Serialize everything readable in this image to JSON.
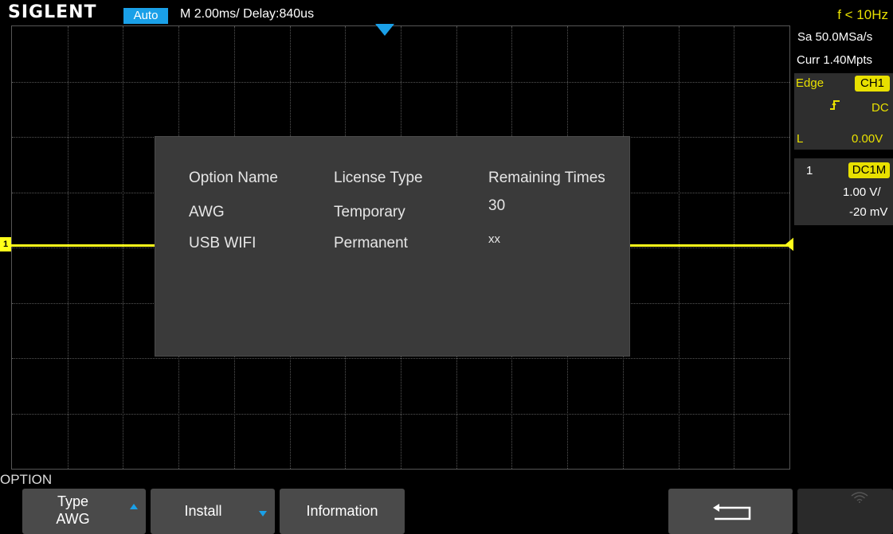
{
  "header": {
    "logo": "SIGLENT",
    "mode": "Auto",
    "timebase": "M 2.00ms/ Delay:840us",
    "frequency": "f < 10Hz"
  },
  "side_panel": {
    "sample_rate": "Sa 50.0MSa/s",
    "memory_depth": "Curr 1.40Mpts",
    "trigger": {
      "type": "Edge",
      "source": "CH1",
      "coupling": "DC",
      "level_label": "L",
      "level_value": "0.00V"
    },
    "channel": {
      "number": "1",
      "coupling_badge": "DC1M",
      "volts_per_div": "1.00 V/",
      "offset": "-20 mV"
    }
  },
  "dialog": {
    "headers": [
      "Option Name",
      "License Type",
      "Remaining Times"
    ],
    "rows": [
      [
        "AWG",
        "Temporary",
        "30"
      ],
      [
        "USB WIFI",
        "Permanent",
        "xx"
      ]
    ]
  },
  "menu": {
    "title": "OPTION",
    "softkeys": {
      "type_label": "Type",
      "type_value": "AWG",
      "install": "Install",
      "information": "Information"
    }
  },
  "markers": {
    "channel_marker": "1"
  },
  "colors": {
    "accent_blue": "#1aa0e8",
    "trace_yellow": "#ffff1a",
    "dialog_bg": "#3a3a3a"
  }
}
